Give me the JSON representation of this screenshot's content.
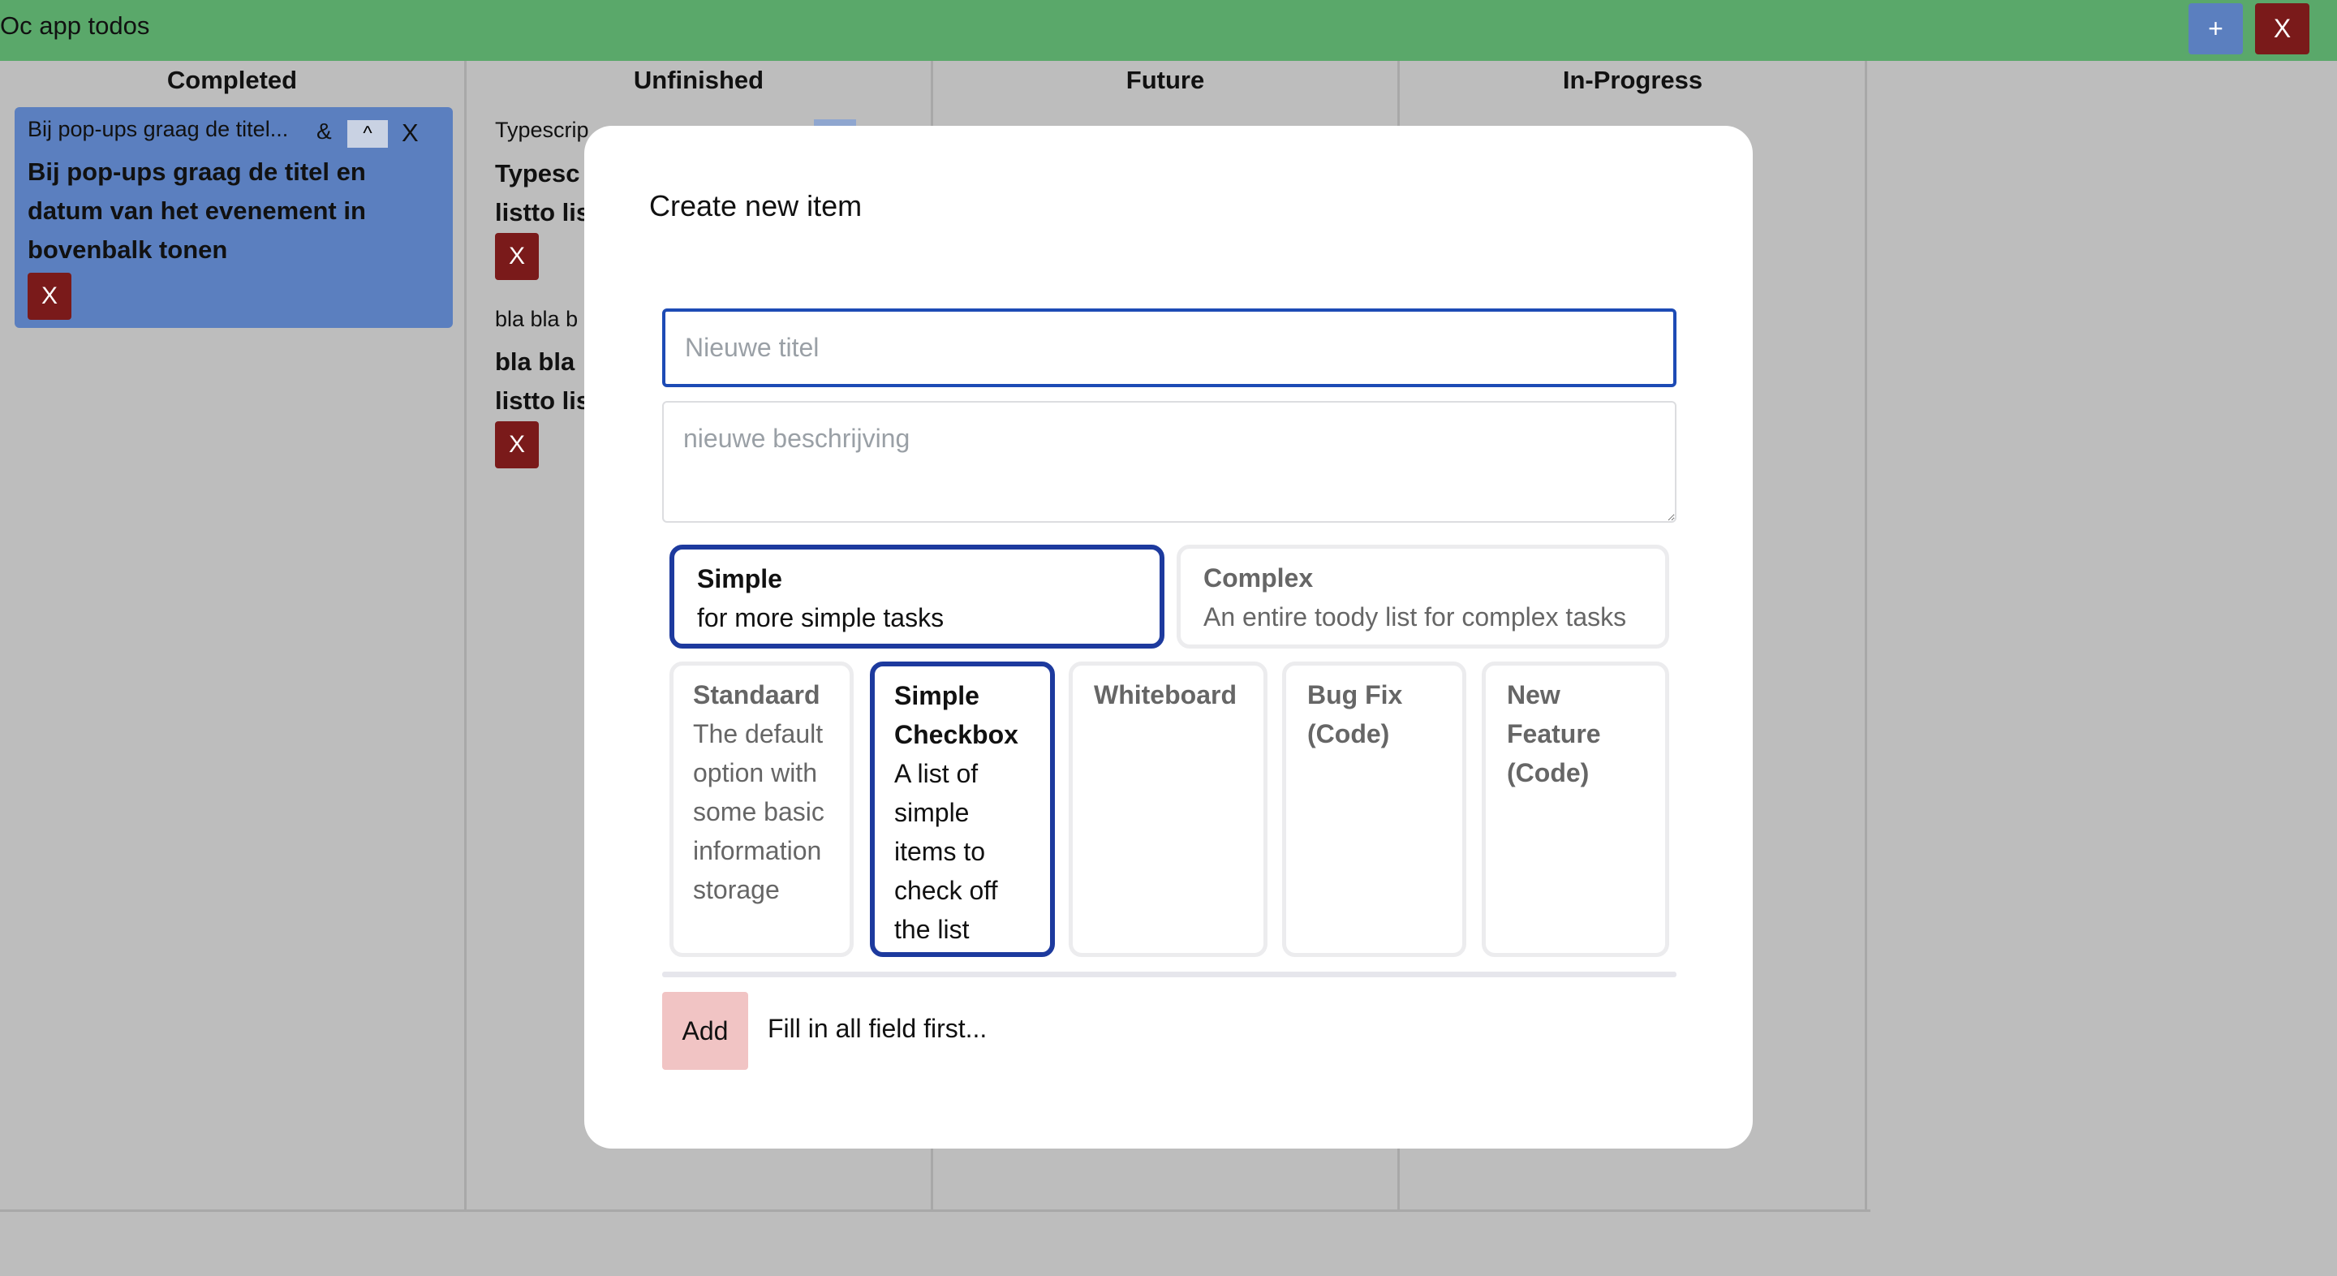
{
  "app": {
    "title": "Oc app todos",
    "add_label": "+",
    "close_label": "X"
  },
  "board": {
    "columns": [
      {
        "title": "Completed"
      },
      {
        "title": "Unfinished"
      },
      {
        "title": "Future"
      },
      {
        "title": "In-Progress"
      }
    ],
    "completed_card": {
      "short_title": "Bij pop-ups graag de titel...",
      "amp": "&",
      "up_label": "^",
      "close_label": "X",
      "title_line1": "Bij pop-ups graag de titel en",
      "title_line2": "datum van het evenement in",
      "title_line3": "bovenbalk tonen",
      "delete_label": "X"
    },
    "unfinished_items": [
      {
        "short_title": "Typescrip",
        "title_line1": "Typesc",
        "title_line2": "listto lis",
        "delete_label": "X"
      },
      {
        "short_title": "bla bla b",
        "title_line1": "bla bla",
        "title_line2": "listto lis",
        "delete_label": "X"
      }
    ]
  },
  "modal": {
    "title": "Create new item",
    "title_placeholder": "Nieuwe titel",
    "description_placeholder": "nieuwe beschrijving",
    "kinds": [
      {
        "name": "Simple",
        "description": "for more simple tasks",
        "selected": true
      },
      {
        "name": "Complex",
        "description": "An entire toody list for complex tasks",
        "selected": false
      }
    ],
    "templates": [
      {
        "name": "Standaard",
        "description": "The default option with some basic information storage",
        "selected": false
      },
      {
        "name": "Simple Checkbox",
        "description": "A list of simple items to check off the list",
        "selected": true
      },
      {
        "name": "Whiteboard",
        "description": "",
        "selected": false
      },
      {
        "name": "Bug Fix (Code)",
        "description": "",
        "selected": false
      },
      {
        "name": "New Feature (Code)",
        "description": "",
        "selected": false
      }
    ],
    "add_label": "Add",
    "hint": "Fill in all field first..."
  },
  "colors": {
    "topbar": "#5aa86a",
    "accent_blue": "#5b7fbf",
    "danger": "#7a1a1a",
    "selected_border": "#1d3a9e"
  }
}
